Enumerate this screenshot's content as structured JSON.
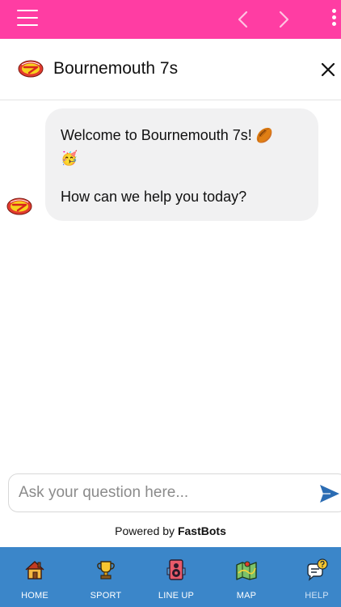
{
  "app": {
    "theme_color": "#ff3da3",
    "tab_bar_color": "#3b86c9"
  },
  "chat": {
    "title": "Bournemouth 7s",
    "message": {
      "line1": "Welcome to Bournemouth 7s!",
      "line1_emoji": "🏉",
      "line2_emoji": "🥳",
      "line3": "How can we help you today?"
    },
    "input": {
      "placeholder": "Ask your question here...",
      "value": ""
    },
    "powered_by_prefix": "Powered by ",
    "powered_by_brand": "FastBots"
  },
  "tabs": [
    {
      "label": "HOME",
      "icon": "house-icon"
    },
    {
      "label": "SPORT",
      "icon": "trophy-icon"
    },
    {
      "label": "LINE UP",
      "icon": "speaker-icon"
    },
    {
      "label": "MAP",
      "icon": "map-icon"
    },
    {
      "label": "HELP",
      "icon": "chat-help-icon",
      "active": true
    }
  ]
}
